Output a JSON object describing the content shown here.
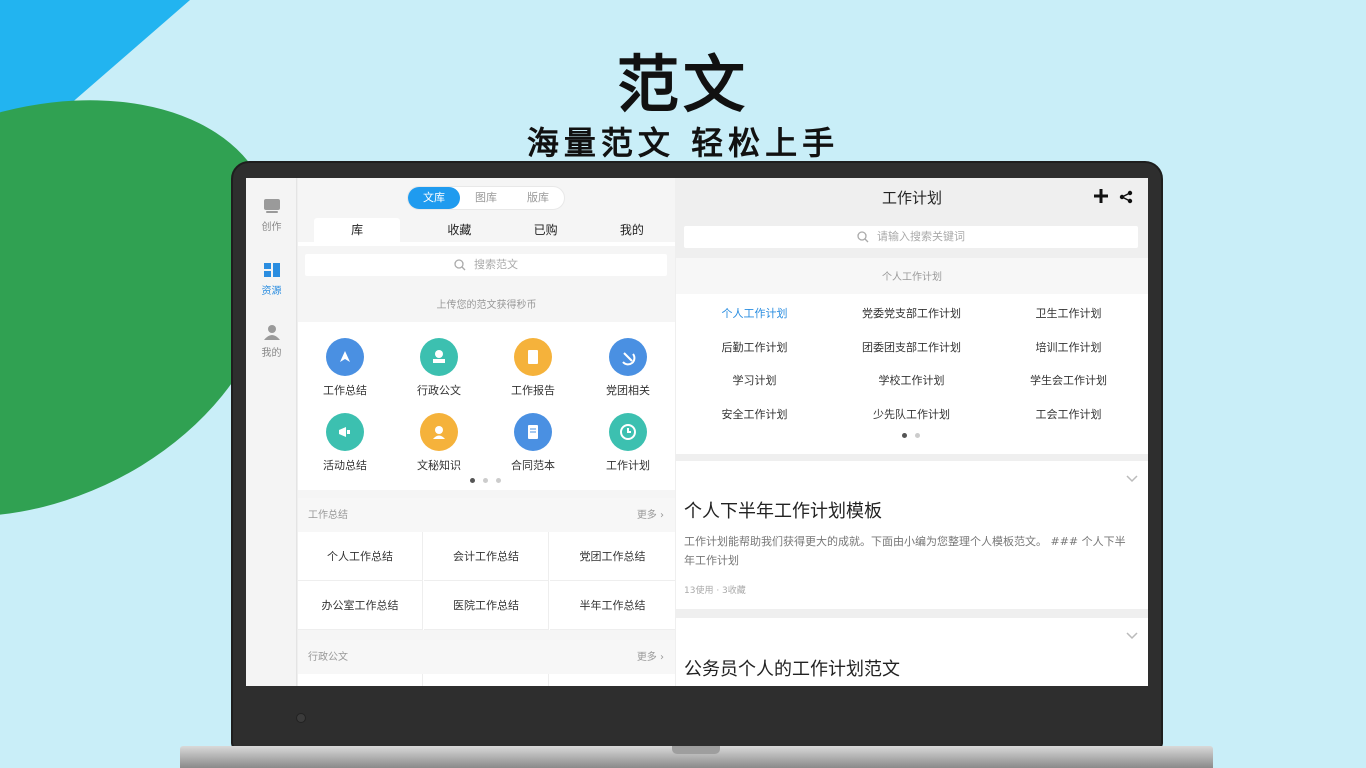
{
  "hero": {
    "title": "范文",
    "subtitle": "海量范文 轻松上手"
  },
  "sidebar": {
    "items": [
      {
        "label": "创作",
        "icon": "edit-icon",
        "active": false
      },
      {
        "label": "资源",
        "icon": "resources-grid-icon",
        "active": true
      },
      {
        "label": "我的",
        "icon": "user-icon",
        "active": false
      }
    ]
  },
  "left": {
    "segments": [
      "文库",
      "图库",
      "版库"
    ],
    "tabs": [
      "库",
      "收藏",
      "已购",
      "我的"
    ],
    "search_placeholder": "搜索范文",
    "upload_hint": "上传您的范文获得秒币",
    "categories": [
      {
        "label": "工作总结",
        "icon": "pen-nib-icon",
        "color": "#4a90e2"
      },
      {
        "label": "行政公文",
        "icon": "stamp-icon",
        "color": "#3cc0b0"
      },
      {
        "label": "工作报告",
        "icon": "report-icon",
        "color": "#f5b23b"
      },
      {
        "label": "党团相关",
        "icon": "hammer-sickle-icon",
        "color": "#4a90e2"
      },
      {
        "label": "活动总结",
        "icon": "megaphone-icon",
        "color": "#3cc0b0"
      },
      {
        "label": "文秘知识",
        "icon": "secretary-icon",
        "color": "#f5b23b"
      },
      {
        "label": "合同范本",
        "icon": "contract-icon",
        "color": "#4a90e2"
      },
      {
        "label": "工作计划",
        "icon": "clock-icon",
        "color": "#3cc0b0"
      }
    ],
    "sections": [
      {
        "title": "工作总结",
        "more": "更多",
        "items": [
          "个人工作总结",
          "会计工作总结",
          "党团工作总结",
          "办公室工作总结",
          "医院工作总结",
          "半年工作总结"
        ]
      },
      {
        "title": "行政公文",
        "more": "更多",
        "items": []
      }
    ]
  },
  "right": {
    "title": "工作计划",
    "search_placeholder": "请输入搜索关键词",
    "filter_label": "个人工作计划",
    "plans": [
      "个人工作计划",
      "党委党支部工作计划",
      "卫生工作计划",
      "后勤工作计划",
      "团委团支部工作计划",
      "培训工作计划",
      "学习计划",
      "学校工作计划",
      "学生会工作计划",
      "安全工作计划",
      "少先队工作计划",
      "工会工作计划"
    ],
    "active_plan": "个人工作计划",
    "articles": [
      {
        "title": "个人下半年工作计划模板",
        "desc": "工作计划能帮助我们获得更大的成就。下面由小编为您整理个人模板范文。 ### 个人下半年工作计划",
        "meta": "13使用 · 3收藏"
      },
      {
        "title": "公务员个人的工作计划范文",
        "desc": "",
        "meta": ""
      }
    ]
  },
  "colors": {
    "background": "#c9eef8",
    "accent_blue": "#1f9bef",
    "deco_green": "#30a152",
    "deco_blue": "#22b4f0"
  }
}
